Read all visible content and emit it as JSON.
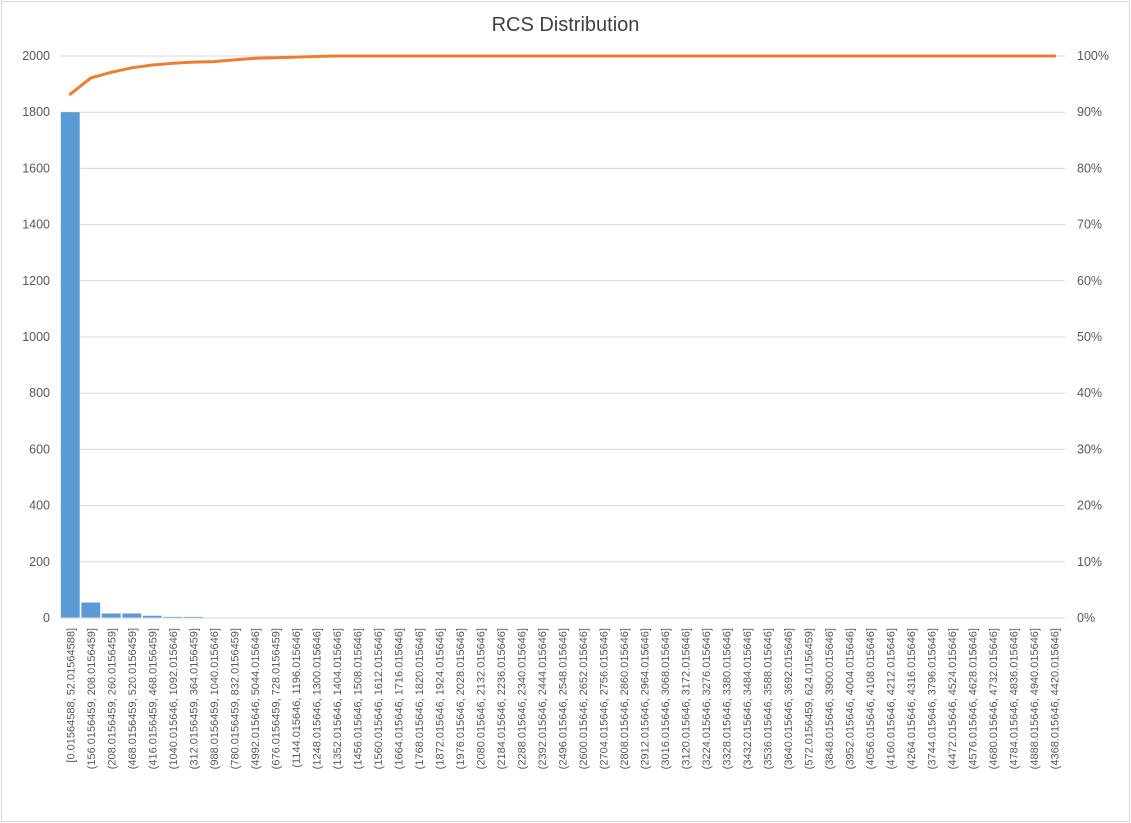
{
  "chart_data": {
    "type": "bar",
    "title": "RCS Distribution",
    "xlabel": "",
    "ylabel": "",
    "ylim": [
      0,
      2000
    ],
    "y_ticks": [
      "0",
      "200",
      "400",
      "600",
      "800",
      "1000",
      "1200",
      "1400",
      "1600",
      "1800",
      "2000"
    ],
    "y2lim": [
      0,
      100
    ],
    "y2_ticks": [
      "0%",
      "10%",
      "20%",
      "30%",
      "40%",
      "50%",
      "60%",
      "70%",
      "80%",
      "90%",
      "100%"
    ],
    "grid": true,
    "categories": [
      "[0.01564588, 52.01564588]",
      "(156.0156459, 208.0156459]",
      "(208.0156459, 260.0156459]",
      "(468.0156459, 520.0156459]",
      "(416.0156459, 468.0156459]",
      "(1040.015646, 1092.015646]",
      "(312.0156459, 364.0156459]",
      "(988.0156459, 1040.015646]",
      "(780.0156459, 832.0156459]",
      "(4992.015646, 5044.015646]",
      "(676.0156459, 728.0156459]",
      "(1144.015646, 1196.015646]",
      "(1248.015646, 1300.015646]",
      "(1352.015646, 1404.015646]",
      "(1456.015646, 1508.015646]",
      "(1560.015646, 1612.015646]",
      "(1664.015646, 1716.015646]",
      "(1768.015646, 1820.015646]",
      "(1872.015646, 1924.015646]",
      "(1976.015646, 2028.015646]",
      "(2080.015646, 2132.015646]",
      "(2184.015646, 2236.015646]",
      "(2288.015646, 2340.015646]",
      "(2392.015646, 2444.015646]",
      "(2496.015646, 2548.015646]",
      "(2600.015646, 2652.015646]",
      "(2704.015646, 2756.015646]",
      "(2808.015646, 2860.015646]",
      "(2912.015646, 2964.015646]",
      "(3016.015646, 3068.015646]",
      "(3120.015646, 3172.015646]",
      "(3224.015646, 3276.015646]",
      "(3328.015646, 3380.015646]",
      "(3432.015646, 3484.015646]",
      "(3536.015646, 3588.015646]",
      "(3640.015646, 3692.015646]",
      "(572.0156459, 624.0156459]",
      "(3848.015646, 3900.015646]",
      "(3952.015646, 4004.015646]",
      "(4056.015646, 4108.015646]",
      "(4160.015646, 4212.015646]",
      "(4264.015646, 4316.015646]",
      "(3744.015646, 3796.015646]",
      "(4472.015646, 4524.015646]",
      "(4576.015646, 4628.015646]",
      "(4680.015646, 4732.015646]",
      "(4784.015646, 4836.015646]",
      "(4888.015646, 4940.015646]",
      "(4368.015646, 4420.015646]"
    ],
    "series": [
      {
        "type": "bar",
        "axis": "left",
        "color": "#5b9bd5",
        "values": [
          1800,
          55,
          16,
          16,
          8,
          4,
          4,
          2,
          2,
          2,
          1,
          1,
          1,
          0,
          0,
          0,
          0,
          0,
          0,
          0,
          0,
          0,
          0,
          0,
          0,
          0,
          0,
          0,
          0,
          0,
          0,
          0,
          0,
          0,
          0,
          0,
          0,
          0,
          0,
          0,
          0,
          0,
          0,
          0,
          0,
          0,
          0,
          0,
          0
        ]
      },
      {
        "type": "line",
        "axis": "right",
        "color": "#ed7d31",
        "values": [
          93.2,
          96.1,
          97.1,
          97.9,
          98.4,
          98.7,
          98.9,
          99.0,
          99.3,
          99.6,
          99.7,
          99.8,
          99.9,
          100,
          100,
          100,
          100,
          100,
          100,
          100,
          100,
          100,
          100,
          100,
          100,
          100,
          100,
          100,
          100,
          100,
          100,
          100,
          100,
          100,
          100,
          100,
          100,
          100,
          100,
          100,
          100,
          100,
          100,
          100,
          100,
          100,
          100,
          100,
          100
        ]
      }
    ]
  }
}
